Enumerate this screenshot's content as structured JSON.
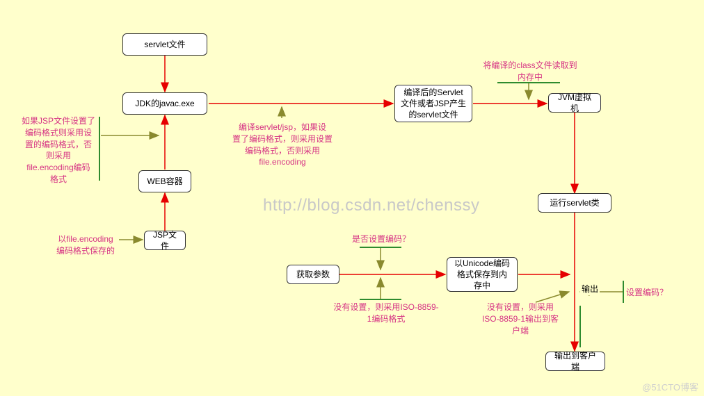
{
  "chart_data": {
    "type": "diagram",
    "title": "JSP/Servlet 编码处理流程",
    "nodes": {
      "servlet_file": "servlet文件",
      "jdk_javac": "JDK的javac.exe",
      "web_container": "WEB容器",
      "jsp_file": "JSP文件",
      "compiled_servlet": "编译后的Servlet\n文件或者JSP产生\n的servlet文件",
      "jvm": "JVM虚拟机",
      "run_servlet": "运行servlet类",
      "get_param": "获取参数",
      "unicode_mem": "以Unicode编码\n格式保存到内\n存中",
      "output_text": "输出",
      "output_client": "输出到客户端"
    },
    "annotations": {
      "jsp_note": "如果JSP文件设置了\n编码格式则采用设\n置的编码格式，否\n则采用\nfile.encoding编码\n格式",
      "save_note": "以file.encoding\n编码格式保存的",
      "compile_note": "编译servlet/jsp，如果设\n置了编码格式，则采用设置\n编码格式，否则采用\nfile.encoding",
      "read_note": "将编译的class文件读取到\n内存中",
      "encode_q": "是否设置编码？",
      "no_set_iso": "没有设置，则采用ISO-8859-\n1编码格式",
      "no_set_out": "没有设置，则采用\nISO-8859-1输出到客\n户端",
      "set_encode_q": "设置编码？"
    },
    "watermark": "http://blog.csdn.net/chenssy",
    "footer": "@51CTO博客",
    "edges": [
      {
        "from": "servlet_file",
        "to": "jdk_javac"
      },
      {
        "from": "jsp_file",
        "to": "web_container",
        "label_ref": "save_note"
      },
      {
        "from": "web_container",
        "to": "jdk_javac",
        "label_ref": "jsp_note"
      },
      {
        "from": "jdk_javac",
        "to": "compiled_servlet",
        "label_ref": "compile_note"
      },
      {
        "from": "compiled_servlet",
        "to": "jvm",
        "label_ref": "read_note"
      },
      {
        "from": "jvm",
        "to": "run_servlet"
      },
      {
        "from": "run_servlet",
        "to": "unicode_mem"
      },
      {
        "from": "get_param",
        "to": "unicode_mem",
        "label_ref": "encode_q"
      },
      {
        "from": "unicode_mem",
        "to": "output_client",
        "label_ref": "no_set_out"
      },
      {
        "from": "annotation",
        "to": "get_param->unicode_mem",
        "label_ref": "no_set_iso"
      },
      {
        "decision": "set_encode_q",
        "target": "output_client"
      }
    ]
  }
}
